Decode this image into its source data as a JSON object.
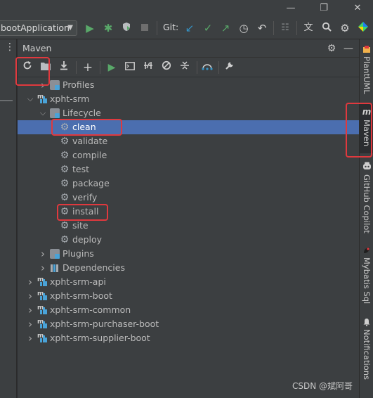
{
  "titlebar": {
    "minimize_icon": "minimize-icon",
    "restore_icon": "restore-icon",
    "close_icon": "close-icon"
  },
  "runbar": {
    "run_config": "bootApplication",
    "git_label": "Git:",
    "icons": [
      "run-icon",
      "debug-icon",
      "coverage-icon",
      "stop-icon",
      "git-update-icon",
      "git-commit-icon",
      "git-push-icon",
      "history-icon",
      "rollback-icon",
      "structure-icon",
      "translate-icon",
      "search-icon",
      "settings-icon",
      "logo-icon"
    ]
  },
  "maven": {
    "title": "Maven",
    "toolbar_icons": [
      "reload-icon",
      "folder-icon",
      "download-icon",
      "add-icon",
      "run-maven-icon",
      "execute-goal-icon",
      "toggle-offline-icon",
      "skip-tests-icon",
      "collapse-icon",
      "show-dependencies-icon",
      "maven-settings-icon"
    ],
    "tree": [
      {
        "label": "Profiles",
        "level": 1,
        "kind": "folder",
        "expanded": false
      },
      {
        "label": "xpht-srm",
        "level": 0,
        "kind": "module",
        "expanded": true
      },
      {
        "label": "Lifecycle",
        "level": 1,
        "kind": "folder",
        "expanded": true
      },
      {
        "label": "clean",
        "level": 2,
        "kind": "goal",
        "selected": true
      },
      {
        "label": "validate",
        "level": 2,
        "kind": "goal"
      },
      {
        "label": "compile",
        "level": 2,
        "kind": "goal"
      },
      {
        "label": "test",
        "level": 2,
        "kind": "goal"
      },
      {
        "label": "package",
        "level": 2,
        "kind": "goal"
      },
      {
        "label": "verify",
        "level": 2,
        "kind": "goal"
      },
      {
        "label": "install",
        "level": 2,
        "kind": "goal"
      },
      {
        "label": "site",
        "level": 2,
        "kind": "goal"
      },
      {
        "label": "deploy",
        "level": 2,
        "kind": "goal"
      },
      {
        "label": "Plugins",
        "level": 1,
        "kind": "folder",
        "expanded": false
      },
      {
        "label": "Dependencies",
        "level": 1,
        "kind": "deps",
        "expanded": false
      },
      {
        "label": "xpht-srm-api",
        "level": 0,
        "kind": "module",
        "expanded": false
      },
      {
        "label": "xpht-srm-boot",
        "level": 0,
        "kind": "module",
        "expanded": false
      },
      {
        "label": "xpht-srm-common",
        "level": 0,
        "kind": "module",
        "expanded": false
      },
      {
        "label": "xpht-srm-purchaser-boot",
        "level": 0,
        "kind": "module",
        "expanded": false
      },
      {
        "label": "xpht-srm-supplier-boot",
        "level": 0,
        "kind": "module",
        "expanded": false
      }
    ]
  },
  "right_tabs": [
    {
      "label": "PlantUML",
      "icon": "plantuml-icon"
    },
    {
      "label": "Maven",
      "icon": "maven-icon",
      "active": true
    },
    {
      "label": "GitHub Copilot",
      "icon": "copilot-icon"
    },
    {
      "label": "Mybatis Sql",
      "icon": "mybatis-icon"
    },
    {
      "label": "Notifications",
      "icon": "bell-icon"
    }
  ],
  "watermark": "CSDN @斌阿哥",
  "colors": {
    "selection": "#4b6eaf",
    "annotation": "#e0393e",
    "run_green": "#59a869",
    "git_blue": "#3592c4"
  }
}
